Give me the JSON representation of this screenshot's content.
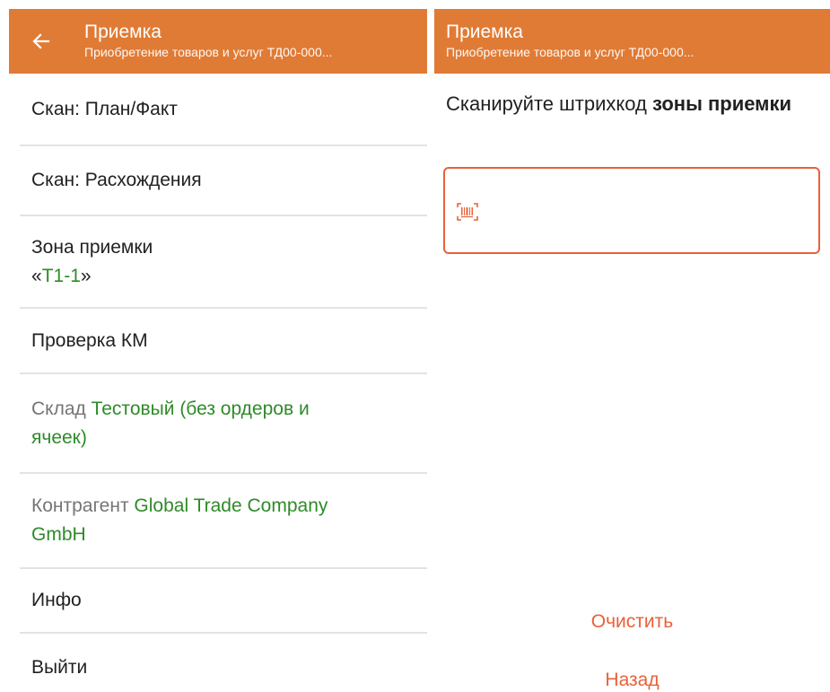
{
  "left_screen": {
    "appbar": {
      "back_icon": "arrow-left-icon",
      "title": "Приемка",
      "subtitle": "Приобретение товаров и услуг ТД00-000..."
    },
    "menu": {
      "scan_plan_fact": "Скан: План/Факт",
      "scan_discrepancies": "Скан: Расхождения",
      "zone_label": "Зона приемки",
      "zone_open_quote": "«",
      "zone_value": "Т1-1",
      "zone_close_quote": "»",
      "km_check": "Проверка КМ",
      "warehouse_label": "Склад ",
      "warehouse_value_line1": "Тестовый (без ордеров и",
      "warehouse_value_line2": "ячеек)",
      "counterparty_label": "Контрагент ",
      "counterparty_value_line1": "Global Trade Company",
      "counterparty_value_line2": "GmbH",
      "info": "Инфо",
      "exit": "Выйти"
    }
  },
  "right_screen": {
    "appbar": {
      "title": "Приемка",
      "subtitle": "Приобретение товаров и услуг ТД00-000..."
    },
    "prompt_text": "Сканируйте штрихкод ",
    "prompt_bold": "зоны приемки",
    "scan_field_icon": "barcode-scan-icon",
    "clear_button": "Очистить",
    "back_button": "Назад"
  },
  "colors": {
    "appbar": "#e07b35",
    "accent": "#e8613a",
    "value_green": "#2e8b28",
    "label_grey": "#757575",
    "divider": "#e3e3e3"
  }
}
